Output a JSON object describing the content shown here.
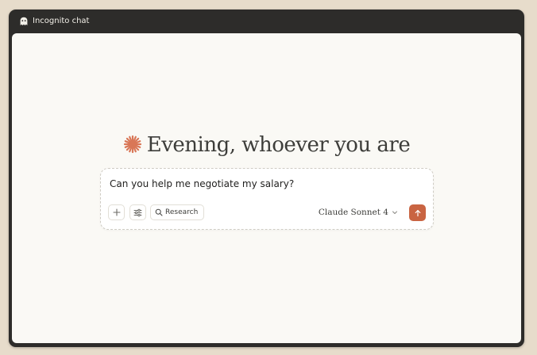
{
  "window": {
    "title": "Incognito chat"
  },
  "greeting": {
    "text": "Evening, whoever you are"
  },
  "composer": {
    "input_value": "Can you help me negotiate my salary?",
    "research_label": "Research",
    "model_label": "Claude Sonnet 4"
  },
  "icons": {
    "title": "ghost-icon",
    "spark": "spark-icon",
    "add": "plus-icon",
    "tools": "sliders-icon",
    "research": "search-icon",
    "model_dropdown": "chevron-down-icon",
    "send": "arrow-up-icon"
  },
  "colors": {
    "accent": "#c96442",
    "background": "#faf9f5",
    "titlebar": "#2d2c2a",
    "desktop": "#e7dccb"
  }
}
